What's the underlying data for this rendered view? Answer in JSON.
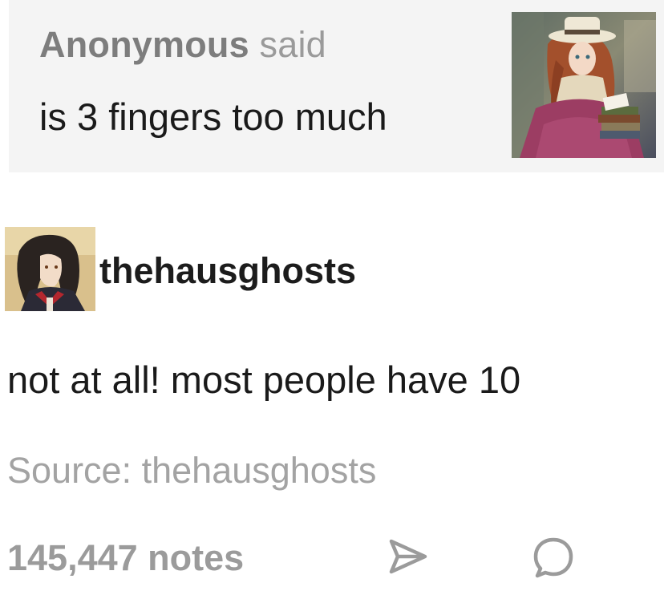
{
  "ask": {
    "asker_name": "Anonymous",
    "said_label": "said",
    "question": "is 3 fingers too much"
  },
  "answer": {
    "blog_name": "thehausghosts",
    "text": "not at all! most people have 10",
    "source_label": "Source:",
    "source_blog": "thehausghosts"
  },
  "footer": {
    "notes": "145,447 notes"
  },
  "icons": {
    "share": "paper-plane-icon",
    "reply": "speech-bubble-icon"
  },
  "colors": {
    "ask_background": "#f4f4f4",
    "muted_text": "#9b9b9b",
    "body_text": "#1a1a1a"
  }
}
